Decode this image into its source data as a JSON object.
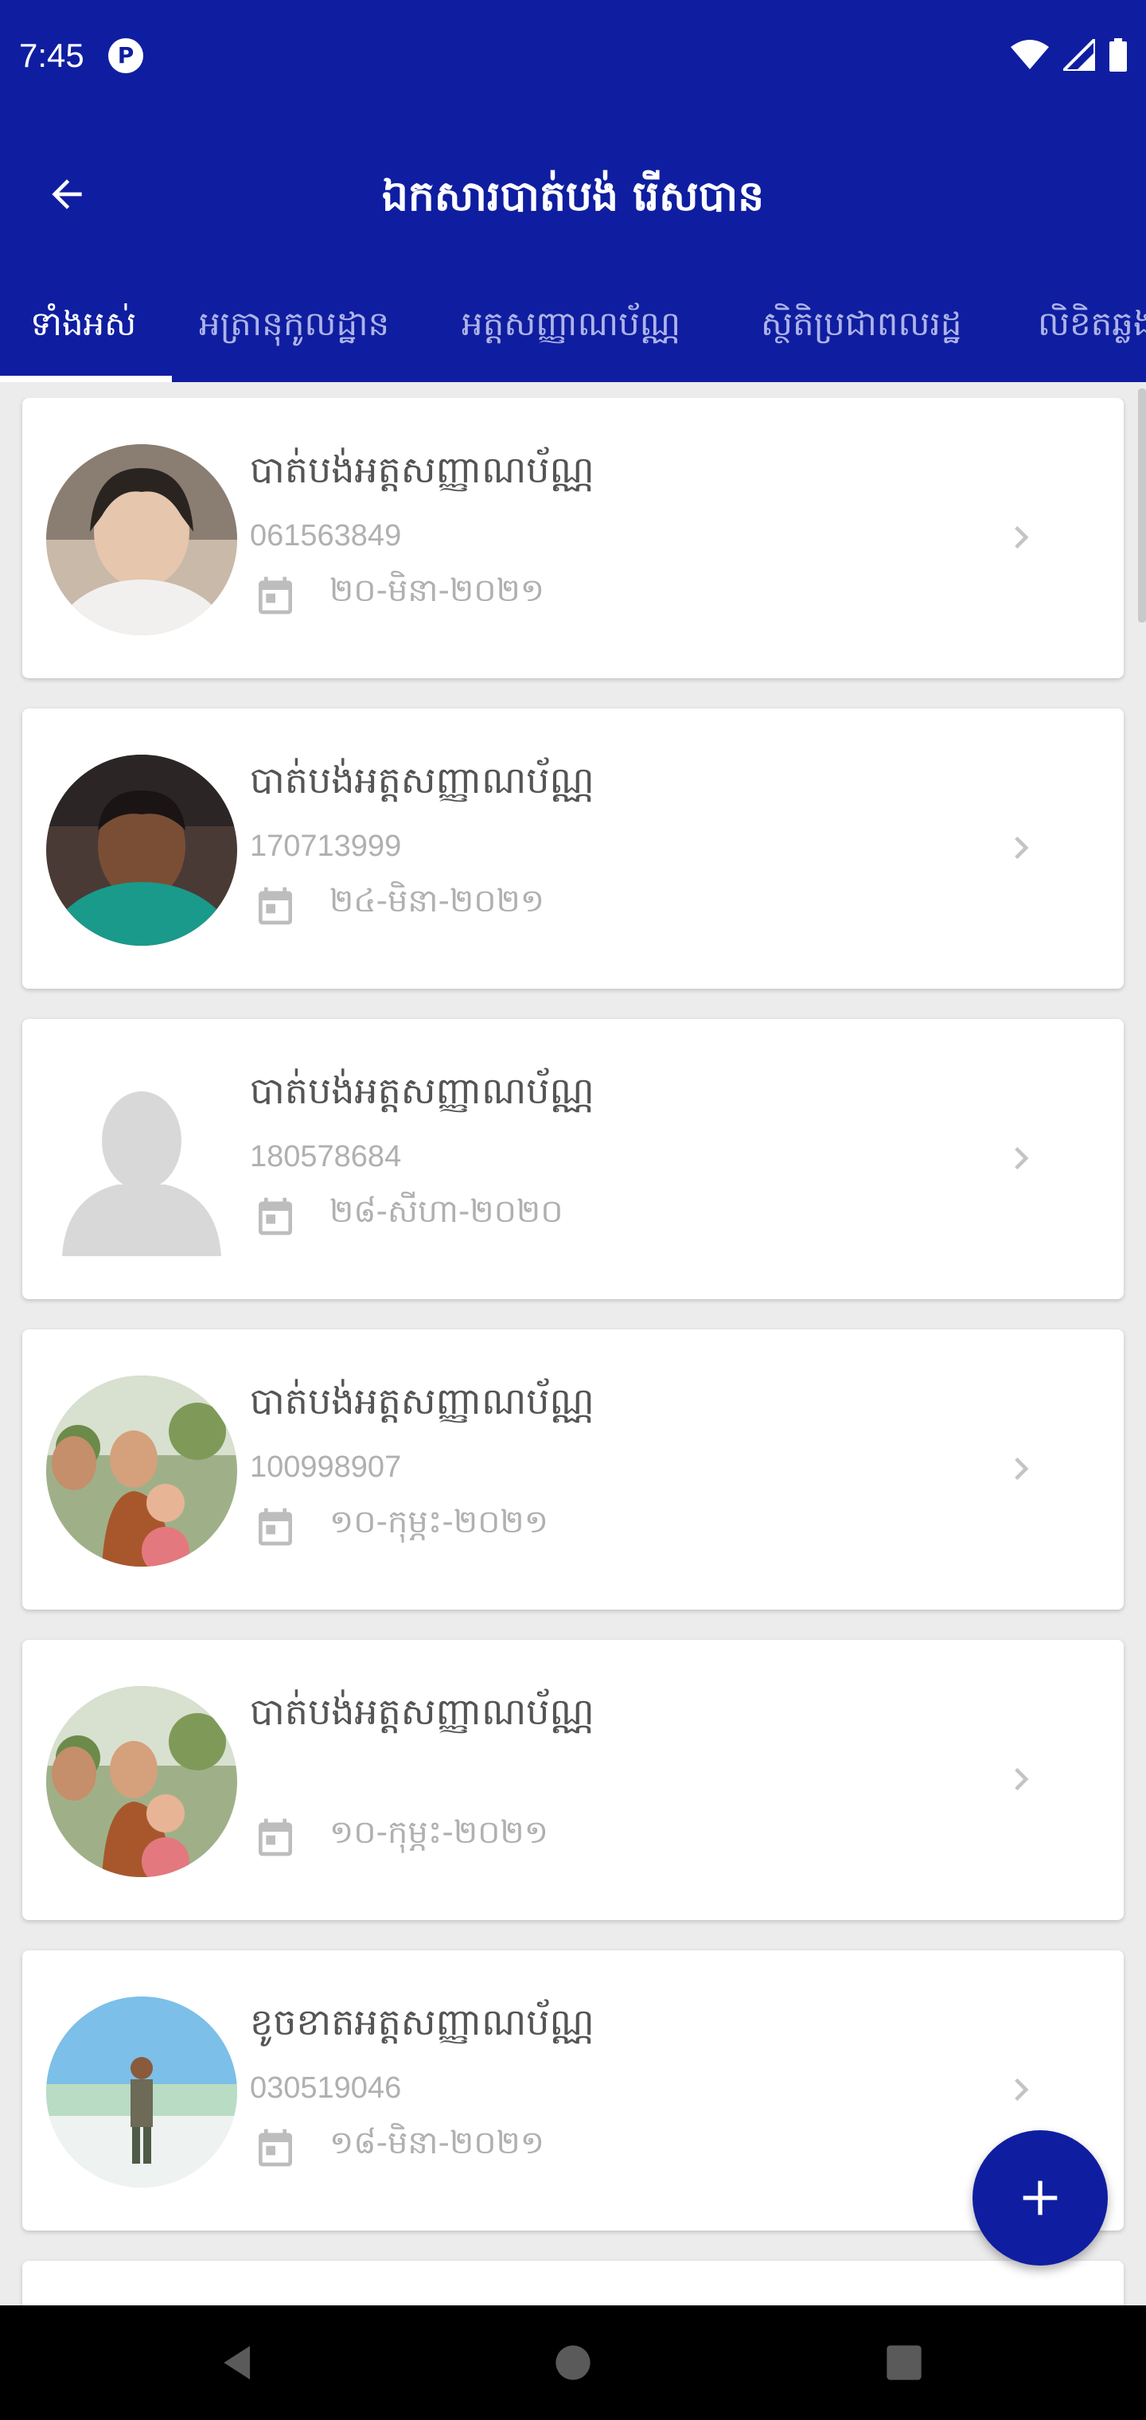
{
  "status_bar": {
    "time": "7:45",
    "app_badge": "P"
  },
  "app_bar": {
    "title": "ឯកសារបាត់បង់ រើសបាន"
  },
  "tabs": [
    {
      "label": "ទាំងអស់",
      "active": true
    },
    {
      "label": "អត្រានុកូលដ្ឋាន",
      "active": false
    },
    {
      "label": "អត្តសញ្ញាណប័ណ្ណ",
      "active": false
    },
    {
      "label": "ស្ថិតិប្រជាពលរដ្ឋ",
      "active": false
    },
    {
      "label": "លិខិតឆ្លង",
      "active": false
    }
  ],
  "items": [
    {
      "title": "បាត់បង់អត្តសញ្ញាណប័ណ្ណ",
      "id": "061563849",
      "date": "២០-មិនា-២០២១",
      "avatar": "photo"
    },
    {
      "title": "បាត់បង់អត្តសញ្ញាណប័ណ្ណ",
      "id": "170713999",
      "date": "២៤-មិនា-២០២១",
      "avatar": "photo"
    },
    {
      "title": "បាត់បង់អត្តសញ្ញាណប័ណ្ណ",
      "id": "180578684",
      "date": "២៨-សីហា-២០២០",
      "avatar": "placeholder"
    },
    {
      "title": "បាត់បង់អត្តសញ្ញាណប័ណ្ណ",
      "id": "100998907",
      "date": "១០-កុម្ភះ-២០២១",
      "avatar": "photo"
    },
    {
      "title": "បាត់បង់អត្តសញ្ញាណប័ណ្ណ",
      "id": "",
      "date": "១០-កុម្ភះ-២០២១",
      "avatar": "photo"
    },
    {
      "title": "ខូចខាតអត្តសញ្ញាណប័ណ្ណ",
      "id": "030519046",
      "date": "១៨-មិនា-២០២១",
      "avatar": "photo"
    }
  ],
  "colors": {
    "primary": "#0f1ea0",
    "background": "#ececec",
    "card": "#ffffff"
  },
  "icons": {
    "back": "arrow-left-icon",
    "date": "calendar-icon",
    "open": "chevron-right-icon",
    "add": "plus-icon"
  }
}
